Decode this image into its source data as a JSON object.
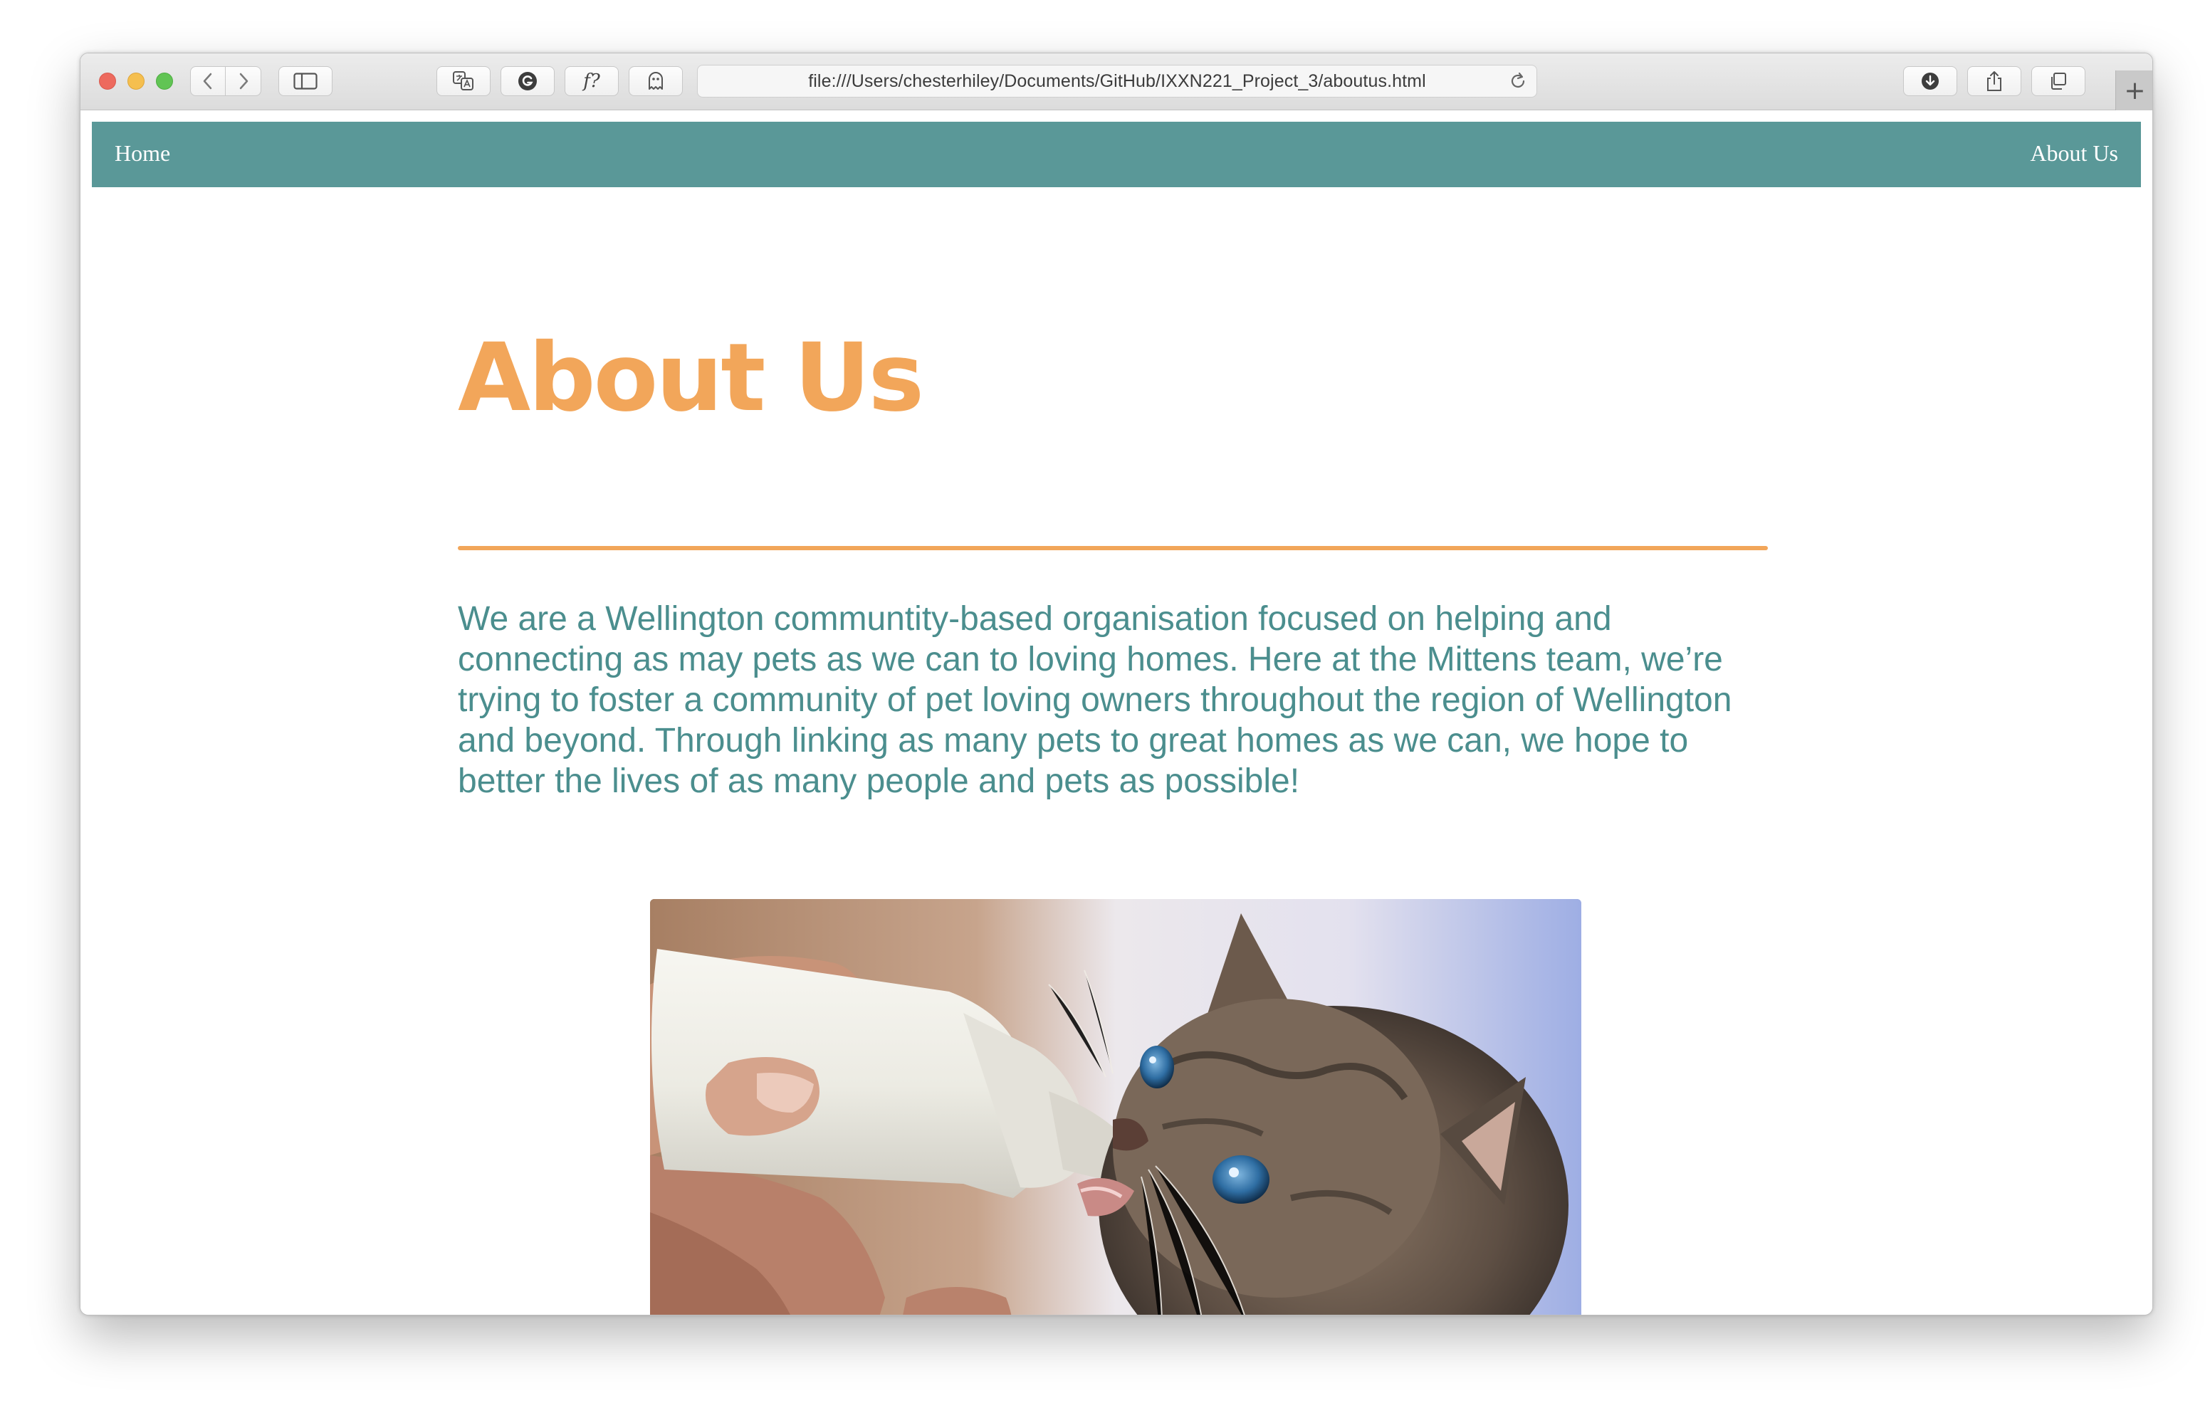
{
  "browser": {
    "url": "file:///Users/chesterhiley/Documents/GitHub/IXXN221_Project_3/aboutus.html",
    "extension_label": "f?",
    "new_tab_label": "+"
  },
  "nav": {
    "home_label": "Home",
    "about_label": "About Us",
    "background_color": "#5a9898"
  },
  "content": {
    "title": "About Us",
    "title_color": "#f2a65a",
    "intro": "We are a Wellington communtity-based organisation focused on helping and connecting as may pets as we can to loving homes. Here at the Mittens team, we’re trying to foster a community of pet loving owners throughout the region of Wellington and beyond. Through linking as many pets to great homes as we can, we hope to better the lives of as many people and pets as possible!",
    "text_color": "#4b8e8e"
  },
  "photo": {
    "subject": "kitten being bottle-fed milk"
  }
}
